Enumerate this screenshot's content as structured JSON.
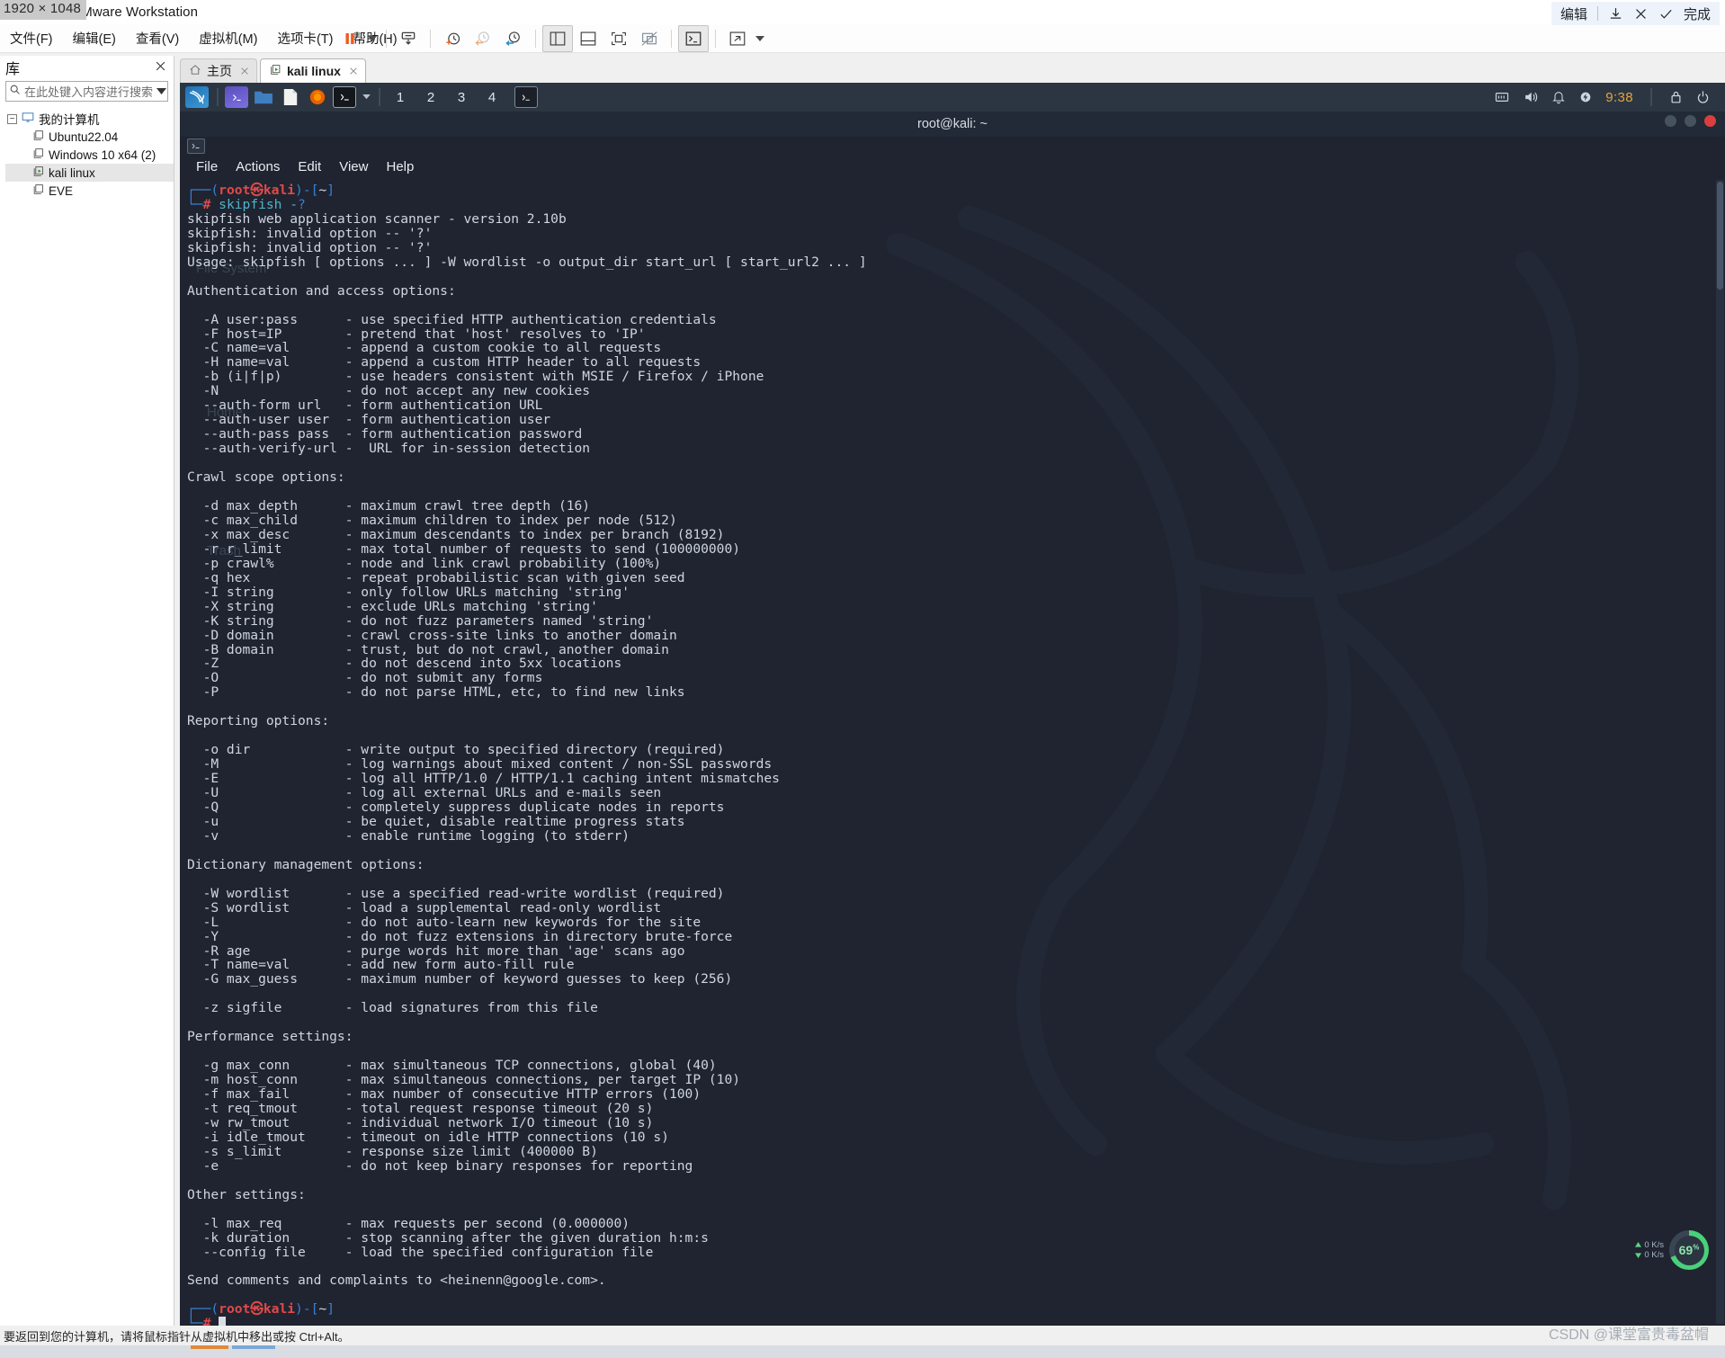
{
  "window": {
    "title": "kali linux - VMware Workstation",
    "resolution_overlay": "1920 × 1048"
  },
  "screenshot_tool": {
    "edit_label": "编辑",
    "save_icon": "download-icon",
    "cancel_icon": "close-icon",
    "confirm_icon": "check-icon",
    "done_label": "完成"
  },
  "menubar": {
    "items": [
      {
        "label": "文件(F)",
        "name": "menu-file"
      },
      {
        "label": "编辑(E)",
        "name": "menu-edit"
      },
      {
        "label": "查看(V)",
        "name": "menu-view"
      },
      {
        "label": "虚拟机(M)",
        "name": "menu-vm"
      },
      {
        "label": "选项卡(T)",
        "name": "menu-tabs"
      },
      {
        "label": "帮助(H)",
        "name": "menu-help"
      }
    ]
  },
  "toolbar": {
    "buttons": [
      {
        "name": "pause-button",
        "icon": "pause-icon"
      },
      {
        "name": "power-dropdown",
        "icon": "chevron-down-icon"
      },
      {
        "name": "snapshot-take-button",
        "icon": "snapshot-download-icon"
      },
      {
        "name": "snapshot-new-button",
        "icon": "clock-plus-icon"
      },
      {
        "name": "snapshot-revert-button",
        "icon": "clock-back-icon"
      },
      {
        "name": "snapshot-manager-button",
        "icon": "clock-wrench-icon"
      },
      {
        "name": "show-library-button",
        "icon": "panel-left-icon"
      },
      {
        "name": "show-thumbnail-bar-button",
        "icon": "panel-bottom-icon"
      },
      {
        "name": "fullscreen-button",
        "icon": "fullscreen-icon"
      },
      {
        "name": "unity-mode-button",
        "icon": "unity-crossed-icon"
      },
      {
        "name": "console-view-button",
        "icon": "terminal-prompt-icon"
      },
      {
        "name": "stretch-button",
        "icon": "expand-diagonal-icon"
      },
      {
        "name": "stretch-dropdown",
        "icon": "chevron-down-icon"
      }
    ]
  },
  "sidebar": {
    "title": "库",
    "close_icon": "close-icon",
    "search": {
      "placeholder": "在此处键入内容进行搜索",
      "value": "",
      "icon": "search-icon",
      "dropdown_icon": "chevron-down-icon"
    },
    "tree": {
      "root": {
        "label": "我的计算机",
        "icon": "monitor-icon",
        "expanded": true
      },
      "items": [
        {
          "label": "Ubuntu22.04",
          "icon": "vm-icon",
          "running": false,
          "selected": false
        },
        {
          "label": "Windows 10 x64 (2)",
          "icon": "vm-icon",
          "running": false,
          "selected": false
        },
        {
          "label": "kali linux",
          "icon": "vm-running-icon",
          "running": true,
          "selected": true
        },
        {
          "label": "EVE",
          "icon": "vm-icon",
          "running": false,
          "selected": false
        }
      ]
    }
  },
  "tabs": {
    "close_library_icon": "close-icon",
    "items": [
      {
        "label": "主页",
        "icon": "home-icon",
        "active": false,
        "close_icon": "close-icon"
      },
      {
        "label": "kali linux",
        "icon": "vm-running-icon",
        "active": true,
        "close_icon": "close-icon"
      }
    ]
  },
  "kali_taskbar": {
    "logo": "kali-dragon-icon",
    "launchers": [
      {
        "name": "taskbar-terminal-launcher",
        "icon": "terminal-icon"
      },
      {
        "name": "taskbar-files-launcher",
        "icon": "folder-icon"
      },
      {
        "name": "taskbar-editor-launcher",
        "icon": "document-icon"
      },
      {
        "name": "taskbar-firefox-launcher",
        "icon": "firefox-icon"
      },
      {
        "name": "taskbar-terminal2-launcher",
        "icon": "terminal-prompt-icon"
      },
      {
        "name": "taskbar-terminal-dropdown",
        "icon": "chevron-down-icon"
      }
    ],
    "workspaces": [
      "1",
      "2",
      "3",
      "4"
    ],
    "active_workspace": "1",
    "open_window_icon": "terminal-window-icon",
    "tray": [
      {
        "name": "network-tray-icon",
        "icon": "network-icon"
      },
      {
        "name": "volume-tray-icon",
        "icon": "speaker-icon"
      },
      {
        "name": "notifications-tray-icon",
        "icon": "bell-icon"
      },
      {
        "name": "power-tray-icon",
        "icon": "power-bolt-icon"
      }
    ],
    "clock": "9:38",
    "lock_icon": "lock-icon",
    "logout_icon": "logout-icon"
  },
  "terminal": {
    "window_title": "root@kali: ~",
    "tab_icon": "terminal-tab-icon",
    "menu": [
      "File",
      "Actions",
      "Edit",
      "View",
      "Help"
    ],
    "window_buttons": [
      "minimize-button",
      "maximize-button",
      "close-button"
    ],
    "prompt": {
      "line1_prefix": "┌──(",
      "user": "root",
      "at": "㉿",
      "host": "kali",
      "line1_suffix": ")-[",
      "path": "~",
      "line1_end": "]",
      "line2_prefix": "└─",
      "hash": "#",
      "command": "skipfish -?"
    },
    "output_lines": [
      "skipfish web application scanner - version 2.10b",
      "skipfish: invalid option -- '?'",
      "skipfish: invalid option -- '?'",
      "Usage: skipfish [ options ... ] -W wordlist -o output_dir start_url [ start_url2 ... ]",
      "",
      "Authentication and access options:",
      "",
      "  -A user:pass      - use specified HTTP authentication credentials",
      "  -F host=IP        - pretend that 'host' resolves to 'IP'",
      "  -C name=val       - append a custom cookie to all requests",
      "  -H name=val       - append a custom HTTP header to all requests",
      "  -b (i|f|p)        - use headers consistent with MSIE / Firefox / iPhone",
      "  -N                - do not accept any new cookies",
      "  --auth-form url   - form authentication URL",
      "  --auth-user user  - form authentication user",
      "  --auth-pass pass  - form authentication password",
      "  --auth-verify-url -  URL for in-session detection",
      "",
      "Crawl scope options:",
      "",
      "  -d max_depth      - maximum crawl tree depth (16)",
      "  -c max_child      - maximum children to index per node (512)",
      "  -x max_desc       - maximum descendants to index per branch (8192)",
      "  -r r_limit        - max total number of requests to send (100000000)",
      "  -p crawl%         - node and link crawl probability (100%)",
      "  -q hex            - repeat probabilistic scan with given seed",
      "  -I string         - only follow URLs matching 'string'",
      "  -X string         - exclude URLs matching 'string'",
      "  -K string         - do not fuzz parameters named 'string'",
      "  -D domain         - crawl cross-site links to another domain",
      "  -B domain         - trust, but do not crawl, another domain",
      "  -Z                - do not descend into 5xx locations",
      "  -O                - do not submit any forms",
      "  -P                - do not parse HTML, etc, to find new links",
      "",
      "Reporting options:",
      "",
      "  -o dir            - write output to specified directory (required)",
      "  -M                - log warnings about mixed content / non-SSL passwords",
      "  -E                - log all HTTP/1.0 / HTTP/1.1 caching intent mismatches",
      "  -U                - log all external URLs and e-mails seen",
      "  -Q                - completely suppress duplicate nodes in reports",
      "  -u                - be quiet, disable realtime progress stats",
      "  -v                - enable runtime logging (to stderr)",
      "",
      "Dictionary management options:",
      "",
      "  -W wordlist       - use a specified read-write wordlist (required)",
      "  -S wordlist       - load a supplemental read-only wordlist",
      "  -L                - do not auto-learn new keywords for the site",
      "  -Y                - do not fuzz extensions in directory brute-force",
      "  -R age            - purge words hit more than 'age' scans ago",
      "  -T name=val       - add new form auto-fill rule",
      "  -G max_guess      - maximum number of keyword guesses to keep (256)",
      "",
      "  -z sigfile        - load signatures from this file",
      "",
      "Performance settings:",
      "",
      "  -g max_conn       - max simultaneous TCP connections, global (40)",
      "  -m host_conn      - max simultaneous connections, per target IP (10)",
      "  -f max_fail       - max number of consecutive HTTP errors (100)",
      "  -t req_tmout      - total request response timeout (20 s)",
      "  -w rw_tmout       - individual network I/O timeout (10 s)",
      "  -i idle_tmout     - timeout on idle HTTP connections (10 s)",
      "  -s s_limit        - response size limit (400000 B)",
      "  -e                - do not keep binary responses for reporting",
      "",
      "Other settings:",
      "",
      "  -l max_req        - max requests per second (0.000000)",
      "  -k duration       - stop scanning after the given duration h:m:s",
      "  --config file     - load the specified configuration file",
      "",
      "Send comments and complaints to <heinenn@google.com>.",
      ""
    ]
  },
  "desktop_ghost_labels": [
    "File System",
    "Home",
    "Trash"
  ],
  "net_widget": {
    "upload": "0 K/s",
    "download": "0 K/s",
    "percent": "69",
    "percent_suffix": "%"
  },
  "statusbar": {
    "text": "要返回到您的计算机，请将鼠标指针从虚拟机中移出或按 Ctrl+Alt。"
  },
  "watermark": {
    "text": "CSDN @课堂富贵毒盆帽"
  },
  "colors": {
    "accent_orange": "#e8762d",
    "kali_bg": "#1f2430",
    "kali_bar": "#2b3642",
    "prompt_red": "#e04a4a",
    "prompt_blue": "#3b7fd4",
    "terminal_text": "#cfd6e0"
  }
}
